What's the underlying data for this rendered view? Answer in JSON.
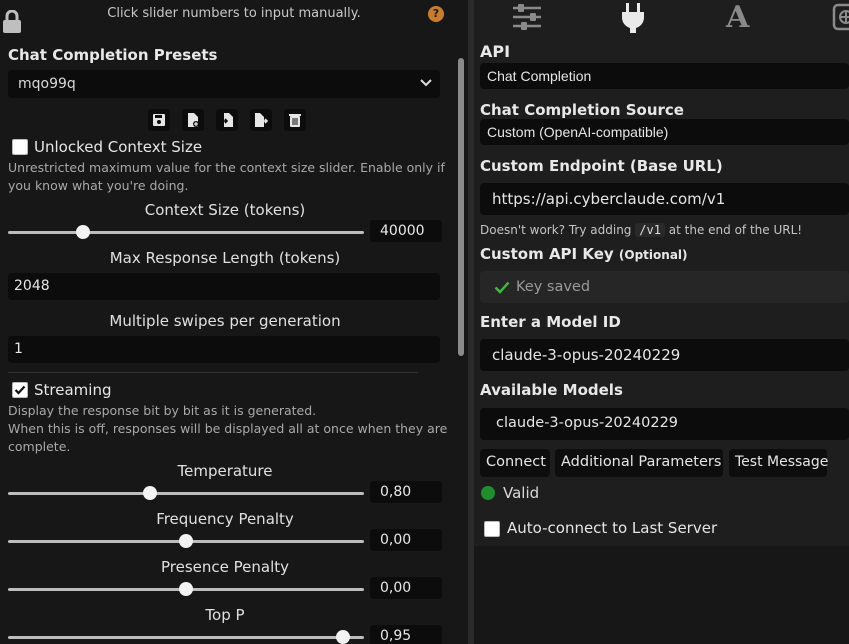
{
  "left": {
    "hint": "Click slider numbers to input manually.",
    "help": "?",
    "presets_title": "Chat Completion Presets",
    "preset_value": "mqo99q",
    "unlocked_label": "Unlocked Context Size",
    "unlocked_note_1": "Unrestricted maximum value for the context size slider. Enable only if",
    "unlocked_note_2": "you know what you're doing.",
    "context_label": "Context Size (tokens)",
    "context_value": "40000",
    "context_fraction": 0.21,
    "max_resp_label": "Max Response Length (tokens)",
    "max_resp_value": "2048",
    "swipes_label": "Multiple swipes per generation",
    "swipes_value": "1",
    "streaming_label": "Streaming",
    "streaming_note_1": "Display the response bit by bit as it is generated.",
    "streaming_note_2": "When this is off, responses will be displayed all at once when they are",
    "streaming_note_3": "complete.",
    "temp_label": "Temperature",
    "temp_value": "0,80",
    "temp_fraction": 0.4,
    "freq_label": "Frequency Penalty",
    "freq_value": "0,00",
    "freq_fraction": 0.5,
    "pres_label": "Presence Penalty",
    "pres_value": "0,00",
    "pres_fraction": 0.5,
    "topp_label": "Top P",
    "topp_value": "0,95",
    "topp_fraction": 0.94
  },
  "right": {
    "api_title": "API",
    "api_value": "Chat Completion",
    "source_title": "Chat Completion Source",
    "source_value": "Custom (OpenAI-compatible)",
    "endpoint_title": "Custom Endpoint (Base URL)",
    "endpoint_value": "https://api.cyberclaude.com/v1",
    "endpoint_hint_pre": "Doesn't work? Try adding",
    "endpoint_hint_code": "/v1",
    "endpoint_hint_post": "at the end of the URL!",
    "key_title": "Custom API Key",
    "key_optional": "(Optional)",
    "key_value": "Key saved",
    "model_id_title": "Enter a Model ID",
    "model_id_value": "claude-3-opus-20240229",
    "models_title": "Available Models",
    "models_value": "claude-3-opus-20240229",
    "btn_connect": "Connect",
    "btn_additional": "Additional Parameters",
    "btn_test": "Test Message",
    "status": "Valid",
    "autoconnect": "Auto-connect to Last Server",
    "colors": {
      "valid": "#1f8f2c",
      "check": "#3bbf3b"
    }
  }
}
